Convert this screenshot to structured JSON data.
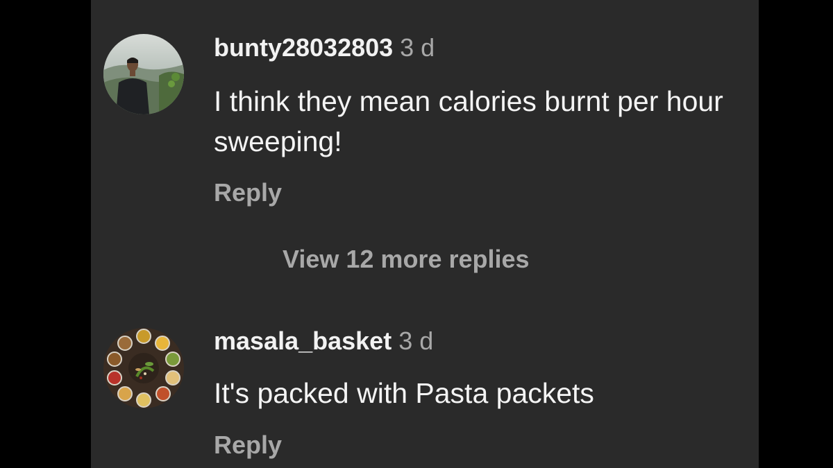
{
  "comments": [
    {
      "username": "bunty28032803",
      "time": "3 d",
      "text": "I think they mean calories burnt per hour sweeping!",
      "reply_label": "Reply",
      "avatar": "person-photo"
    },
    {
      "username": "masala_basket",
      "time": "3 d",
      "text": "It's packed with Pasta packets",
      "reply_label": "Reply",
      "avatar": "spice-bowls-photo"
    }
  ],
  "view_more_label": "View 12 more replies",
  "colors": {
    "background": "#2a2a2a",
    "outer": "#000000",
    "primary_text": "#f4f4f4",
    "secondary_text": "#a8a8a8"
  }
}
